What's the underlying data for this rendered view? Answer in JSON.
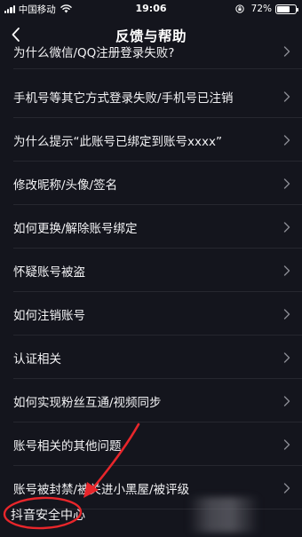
{
  "status_bar": {
    "carrier": "中国移动",
    "time": "19:06",
    "battery": "72%",
    "battery_level": 0.72
  },
  "nav": {
    "title": "反馈与帮助",
    "back_icon": "chevron-left-icon"
  },
  "items": [
    {
      "label": "为什么微信/QQ注册登录失败?"
    },
    {
      "label": "手机号等其它方式登录失败/手机号已注销"
    },
    {
      "label": "为什么提示“此账号已绑定到账号xxxx”"
    },
    {
      "label": "修改昵称/头像/签名"
    },
    {
      "label": "如何更换/解除账号绑定"
    },
    {
      "label": "怀疑账号被盗"
    },
    {
      "label": "如何注销账号"
    },
    {
      "label": "认证相关"
    },
    {
      "label": "如何实现粉丝互通/视频同步"
    },
    {
      "label": "账号相关的其他问题"
    },
    {
      "label": "账号被封禁/被关进小黑屋/被评级"
    },
    {
      "label": "抖音安全中心"
    }
  ],
  "colors": {
    "background": "#14151d",
    "text": "#f2f2f4",
    "chevron": "#8a8b93",
    "annotation": "#e8262b"
  }
}
